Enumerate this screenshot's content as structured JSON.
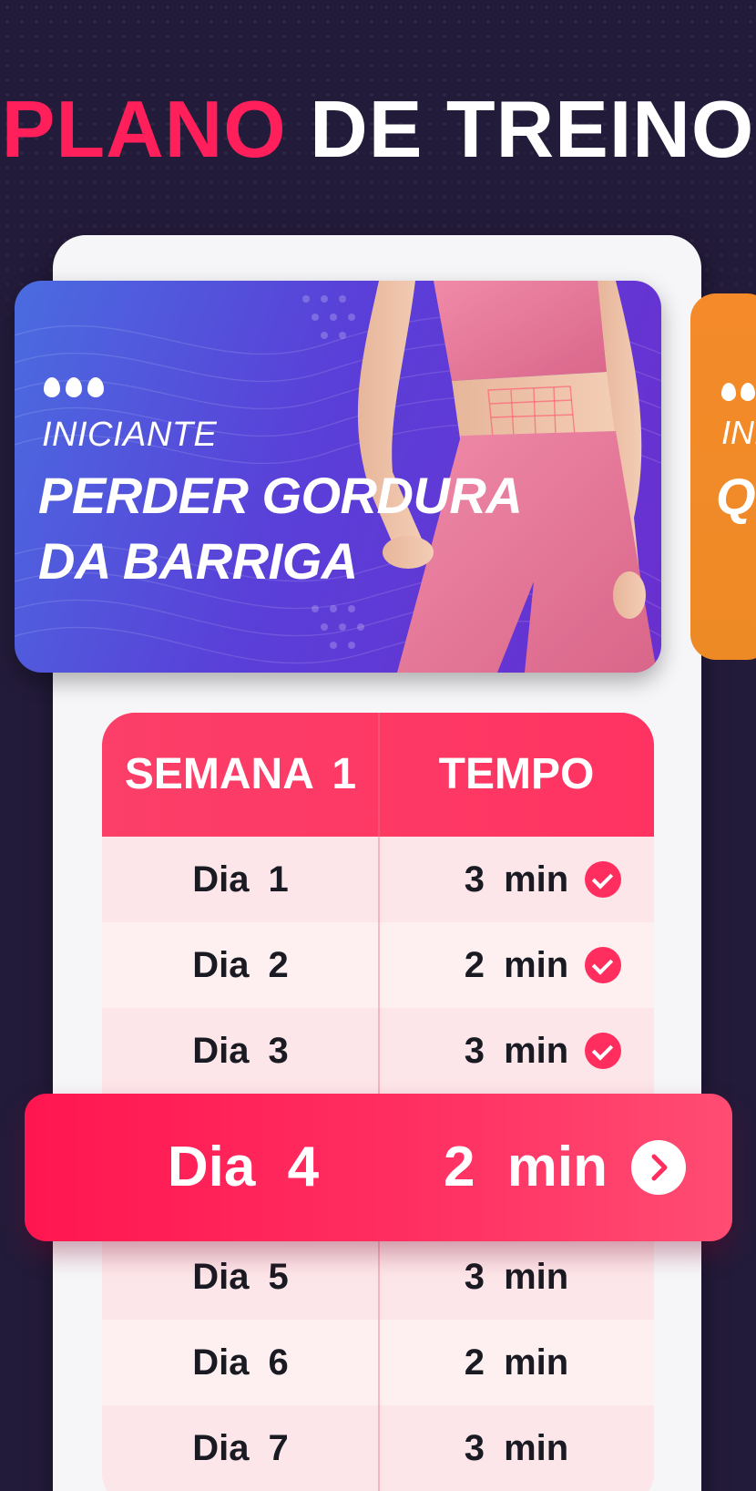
{
  "headline": {
    "accent": "PLANO",
    "rest": "DE TREINO"
  },
  "hero_card": {
    "level": "INICIANTE",
    "title": "PERDER GORDURA DA BARRIGA",
    "flame_count": 3,
    "colors": {
      "start": "#4a6ce0",
      "end": "#6a2fd0"
    }
  },
  "next_card": {
    "level": "INICIANTE",
    "title": "Q",
    "color": "#f48a2a"
  },
  "plan_table": {
    "week_header": "SEMANA 1",
    "time_header": "TEMPO",
    "rows": [
      {
        "day": "Dia 1",
        "time": "3 min",
        "completed": true
      },
      {
        "day": "Dia 2",
        "time": "2 min",
        "completed": true
      },
      {
        "day": "Dia 3",
        "time": "3 min",
        "completed": true
      },
      {
        "day": "Dia 4",
        "time": "2 min",
        "current": true
      },
      {
        "day": "Dia 5",
        "time": "3 min",
        "completed": false
      },
      {
        "day": "Dia 6",
        "time": "2 min",
        "completed": false
      },
      {
        "day": "Dia 7",
        "time": "3 min",
        "completed": false
      }
    ]
  },
  "current_day": {
    "day": "Dia 4",
    "time": "2 min",
    "action_icon": "chevron-right-icon"
  },
  "accent_color": "#ff2e5f"
}
